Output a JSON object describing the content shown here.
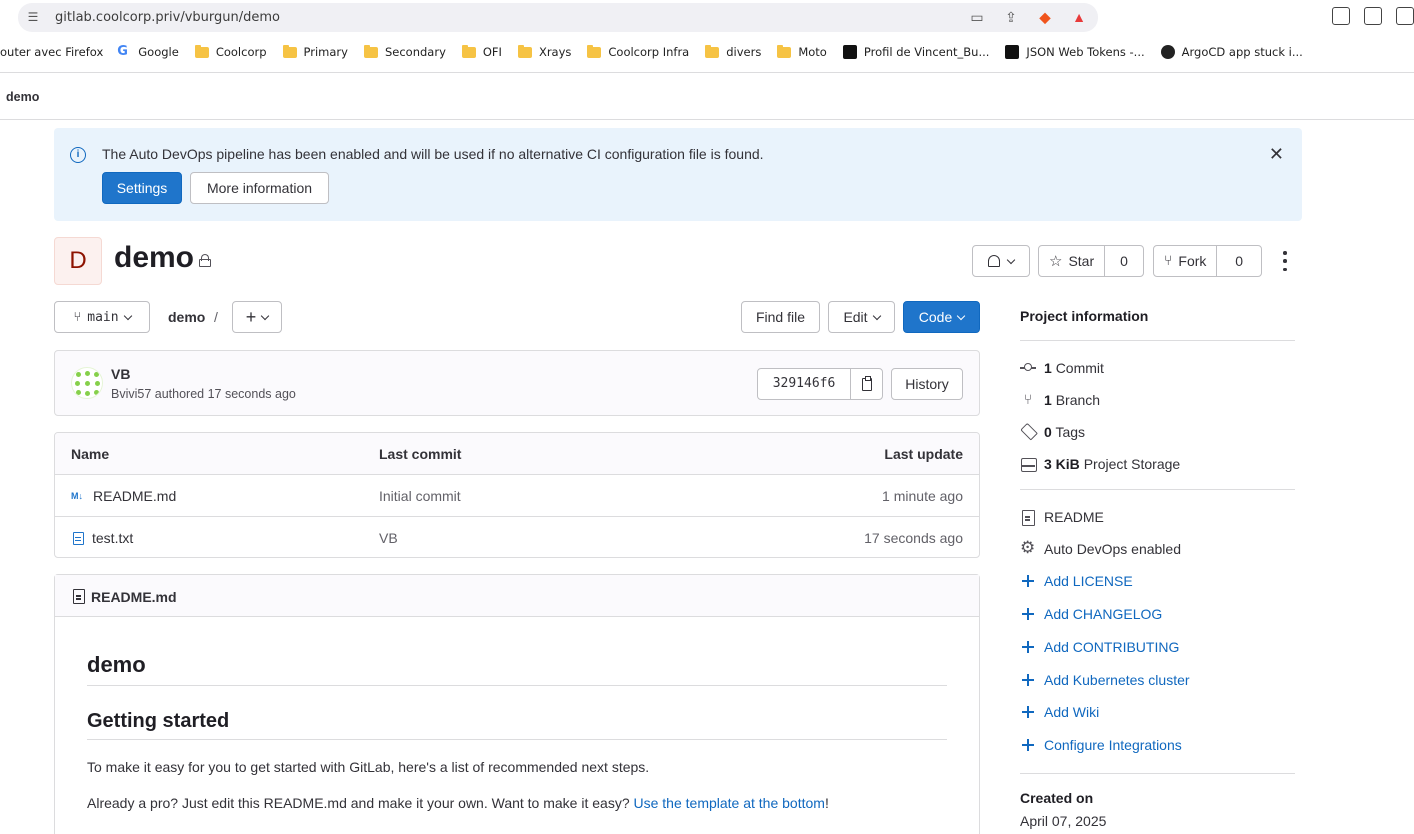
{
  "browser": {
    "url": "gitlab.coolcorp.priv/vburgun/demo",
    "bookmarks": [
      {
        "label": "outer avec Firefox",
        "icon": "none"
      },
      {
        "label": "Google",
        "icon": "google-icon"
      },
      {
        "label": "Coolcorp",
        "icon": "folder-icon"
      },
      {
        "label": "Primary",
        "icon": "folder-icon"
      },
      {
        "label": "Secondary",
        "icon": "folder-icon"
      },
      {
        "label": "OFI",
        "icon": "folder-icon"
      },
      {
        "label": "Xrays",
        "icon": "folder-icon"
      },
      {
        "label": "Coolcorp Infra",
        "icon": "folder-icon"
      },
      {
        "label": "divers",
        "icon": "folder-icon"
      },
      {
        "label": "Moto",
        "icon": "folder-icon"
      },
      {
        "label": "Profil de Vincent_Bu...",
        "icon": "profile-icon"
      },
      {
        "label": "JSON Web Tokens -...",
        "icon": "jwt-icon"
      },
      {
        "label": "ArgoCD app stuck i...",
        "icon": "github-icon"
      }
    ]
  },
  "breadcrumb": {
    "current": "demo"
  },
  "alert": {
    "message": "The Auto DevOps pipeline has been enabled and will be used if no alternative CI configuration file is found.",
    "settings_label": "Settings",
    "more_label": "More information",
    "close_glyph": "✕"
  },
  "project": {
    "avatar_letter": "D",
    "title": "demo",
    "star_label": "Star",
    "star_count": "0",
    "fork_label": "Fork",
    "fork_count": "0"
  },
  "toolbar": {
    "branch": "main",
    "path": "demo",
    "path_sep": "/",
    "plus": "+",
    "find_file": "Find file",
    "edit": "Edit",
    "code": "Code"
  },
  "commit": {
    "title": "VB",
    "meta": "Bvivi57 authored 17 seconds ago",
    "sha": "329146f6",
    "history": "History"
  },
  "files": {
    "headers": {
      "name": "Name",
      "last_commit": "Last commit",
      "last_update": "Last update"
    },
    "rows": [
      {
        "name": "README.md",
        "icon": "markdown-icon",
        "commit": "Initial commit",
        "update": "1 minute ago"
      },
      {
        "name": "test.txt",
        "icon": "file-icon",
        "commit": "VB",
        "update": "17 seconds ago"
      }
    ]
  },
  "readme": {
    "filename": "README.md",
    "h1": "demo",
    "h2": "Getting started",
    "p1": "To make it easy for you to get started with GitLab, here's a list of recommended next steps.",
    "p2_prefix": "Already a pro? Just edit this README.md and make it your own. Want to make it easy? ",
    "p2_link": "Use the template at the bottom",
    "p2_suffix": "!"
  },
  "sidebar": {
    "title": "Project information",
    "stats": [
      {
        "count": "1",
        "label": "Commit",
        "icon": "commit-icon"
      },
      {
        "count": "1",
        "label": "Branch",
        "icon": "branch-icon"
      },
      {
        "count": "0",
        "label": "Tags",
        "icon": "tag-icon"
      },
      {
        "count": "3 KiB",
        "label": "Project Storage",
        "icon": "storage-icon"
      }
    ],
    "readme": "README",
    "autodevops": "Auto DevOps enabled",
    "links": [
      "Add LICENSE",
      "Add CHANGELOG",
      "Add CONTRIBUTING",
      "Add Kubernetes cluster",
      "Add Wiki",
      "Configure Integrations"
    ],
    "created_title": "Created on",
    "created_date": "April 07, 2025"
  }
}
